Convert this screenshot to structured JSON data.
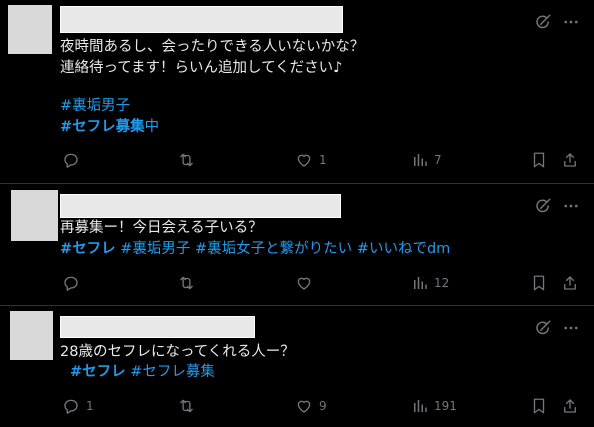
{
  "colors": {
    "background": "#000000",
    "text": "#e7e9ea",
    "hashtag": "#1d9bf0",
    "icon": "#71767b",
    "divider": "#2f3336",
    "placeholder": "#d9d9d9"
  },
  "posts": [
    {
      "lines": [
        "夜時間あるし、会ったりできる人いないかな？",
        "連絡待ってます！らいん追加してください♪"
      ],
      "tags": [
        "#裏垢男子"
      ],
      "tag_line2": {
        "bold": "#セフレ募集",
        "plain": "中"
      },
      "stats": {
        "replies": "",
        "reposts": "",
        "likes": "1",
        "views": "7"
      }
    },
    {
      "lines": [
        "再募集ー！今日会える子いる？"
      ],
      "tags": [
        "#セフレ",
        "#裏垢男子",
        "#裏垢女子と繋がりたい",
        "#いいねでdm"
      ],
      "stats": {
        "replies": "",
        "reposts": "",
        "likes": "",
        "views": "12"
      }
    },
    {
      "lines": [
        "28歳のセフレになってくれる人ー？"
      ],
      "tags": [
        "#セフレ",
        "#セフレ募集"
      ],
      "stats": {
        "replies": "1",
        "reposts": "",
        "likes": "9",
        "views": "191"
      }
    }
  ],
  "icons": {
    "grok": "grok-icon",
    "more": "more-icon",
    "reply": "reply-icon",
    "repost": "repost-icon",
    "like": "like-icon",
    "views": "views-icon",
    "bookmark": "bookmark-icon",
    "share": "share-icon"
  }
}
